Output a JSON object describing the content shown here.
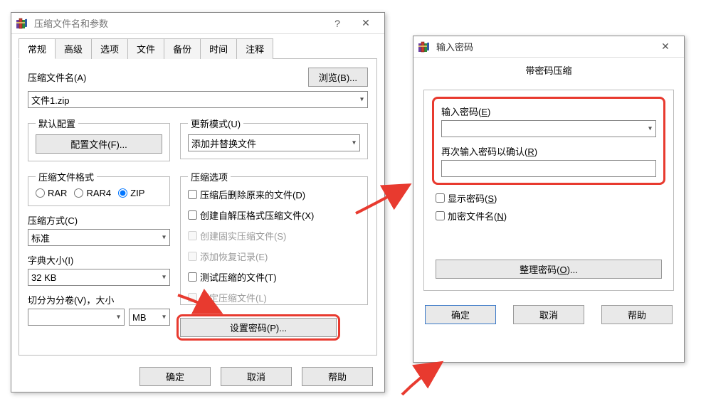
{
  "main_dialog": {
    "title": "压缩文件名和参数",
    "help_btn": "?",
    "close_btn": "✕",
    "tabs": [
      "常规",
      "高级",
      "选项",
      "文件",
      "备份",
      "时间",
      "注释"
    ],
    "active_tab": 0,
    "archive_name_label": "压缩文件名(A)",
    "browse_btn": "浏览(B)...",
    "archive_name_value": "文件1.zip",
    "default_profile": {
      "legend": "默认配置",
      "button": "配置文件(F)..."
    },
    "update_mode": {
      "legend": "更新模式(U)",
      "value": "添加并替换文件"
    },
    "format": {
      "legend": "压缩文件格式",
      "options": [
        "RAR",
        "RAR4",
        "ZIP"
      ],
      "selected": "ZIP"
    },
    "compress_options": {
      "legend": "压缩选项",
      "items": [
        {
          "label": "压缩后删除原来的文件(D)",
          "checked": false,
          "disabled": false
        },
        {
          "label": "创建自解压格式压缩文件(X)",
          "checked": false,
          "disabled": false
        },
        {
          "label": "创建固实压缩文件(S)",
          "checked": false,
          "disabled": true
        },
        {
          "label": "添加恢复记录(E)",
          "checked": false,
          "disabled": true
        },
        {
          "label": "测试压缩的文件(T)",
          "checked": false,
          "disabled": false
        },
        {
          "label": "锁定压缩文件(L)",
          "checked": false,
          "disabled": true
        }
      ]
    },
    "method_label": "压缩方式(C)",
    "method_value": "标准",
    "dict_label": "字典大小(I)",
    "dict_value": "32 KB",
    "split_label": "切分为分卷(V)，大小",
    "split_value": "",
    "split_unit": "MB",
    "set_password_btn": "设置密码(P)...",
    "ok": "确定",
    "cancel": "取消",
    "help": "帮助"
  },
  "password_dialog": {
    "title": "输入密码",
    "close_btn": "✕",
    "header": "带密码压缩",
    "enter_label_pre": "输入密码(",
    "enter_label_u": "E",
    "enter_label_post": ")",
    "reenter_label_pre": "再次输入密码以确认(",
    "reenter_label_u": "R",
    "reenter_label_post": ")",
    "show_pre": "显示密码(",
    "show_u": "S",
    "show_post": ")",
    "encrypt_pre": "加密文件名(",
    "encrypt_u": "N",
    "encrypt_post": ")",
    "organize_pre": "整理密码(",
    "organize_u": "O",
    "organize_post": ")...",
    "ok": "确定",
    "cancel": "取消",
    "help": "帮助"
  }
}
